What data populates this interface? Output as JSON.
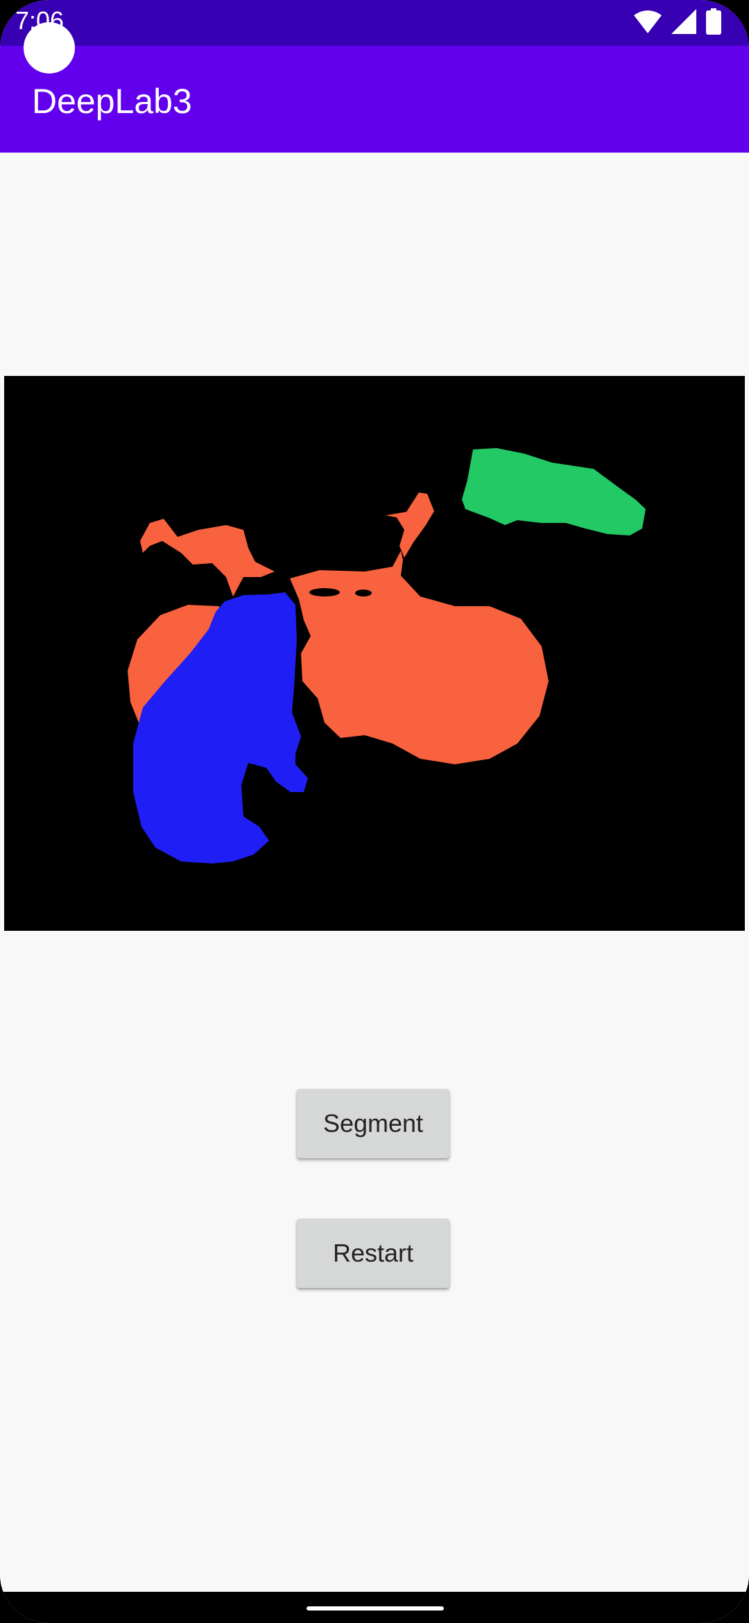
{
  "status_bar": {
    "time": "7:06",
    "icons": [
      "wifi-icon",
      "signal-icon",
      "battery-icon"
    ]
  },
  "app_bar": {
    "title": "DeepLab3"
  },
  "segmentation": {
    "classes": [
      {
        "name": "orange-region",
        "color": "#f9623e"
      },
      {
        "name": "blue-region",
        "color": "#1f1ef5"
      },
      {
        "name": "green-region",
        "color": "#22c964"
      }
    ],
    "background_color": "#000000"
  },
  "buttons": {
    "segment_label": "Segment",
    "restart_label": "Restart"
  },
  "colors": {
    "status_bar": "#3700b3",
    "app_bar": "#6200ee",
    "background": "#f8f8f8",
    "button": "#d6d7d7"
  }
}
